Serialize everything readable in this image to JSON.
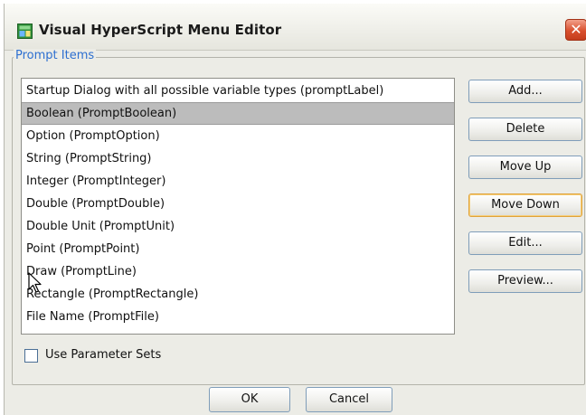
{
  "window": {
    "title": "Visual HyperScript Menu Editor",
    "close_glyph": "✕"
  },
  "prompt_items": {
    "group_label": "Prompt Items",
    "items": [
      {
        "label": "Startup Dialog with all possible variable types (promptLabel)",
        "selected": false
      },
      {
        "label": "Boolean (PromptBoolean)",
        "selected": true
      },
      {
        "label": "Option (PromptOption)",
        "selected": false
      },
      {
        "label": "String (PromptString)",
        "selected": false
      },
      {
        "label": "Integer (PromptInteger)",
        "selected": false
      },
      {
        "label": "Double (PromptDouble)",
        "selected": false
      },
      {
        "label": "Double Unit (PromptUnit)",
        "selected": false
      },
      {
        "label": "Point (PromptPoint)",
        "selected": false
      },
      {
        "label": "Draw (PromptLine)",
        "selected": false
      },
      {
        "label": "Rectangle (PromptRectangle)",
        "selected": false
      },
      {
        "label": "File Name (PromptFile)",
        "selected": false
      }
    ]
  },
  "side_buttons": {
    "add": "Add...",
    "delete": "Delete",
    "move_up": "Move Up",
    "move_down": "Move Down",
    "edit": "Edit...",
    "preview": "Preview..."
  },
  "parameter_sets": {
    "label": "Use Parameter Sets",
    "checked": false
  },
  "footer": {
    "ok": "OK",
    "cancel": "Cancel"
  },
  "colors": {
    "group_title": "#2d6fd0",
    "selection": "#bcbcbc",
    "close_button": "#d9502e",
    "focus_ring": "#e0a23a"
  },
  "icons": {
    "app": "menu-editor-app-icon",
    "close": "close-icon",
    "cursor": "mouse-pointer-icon"
  }
}
